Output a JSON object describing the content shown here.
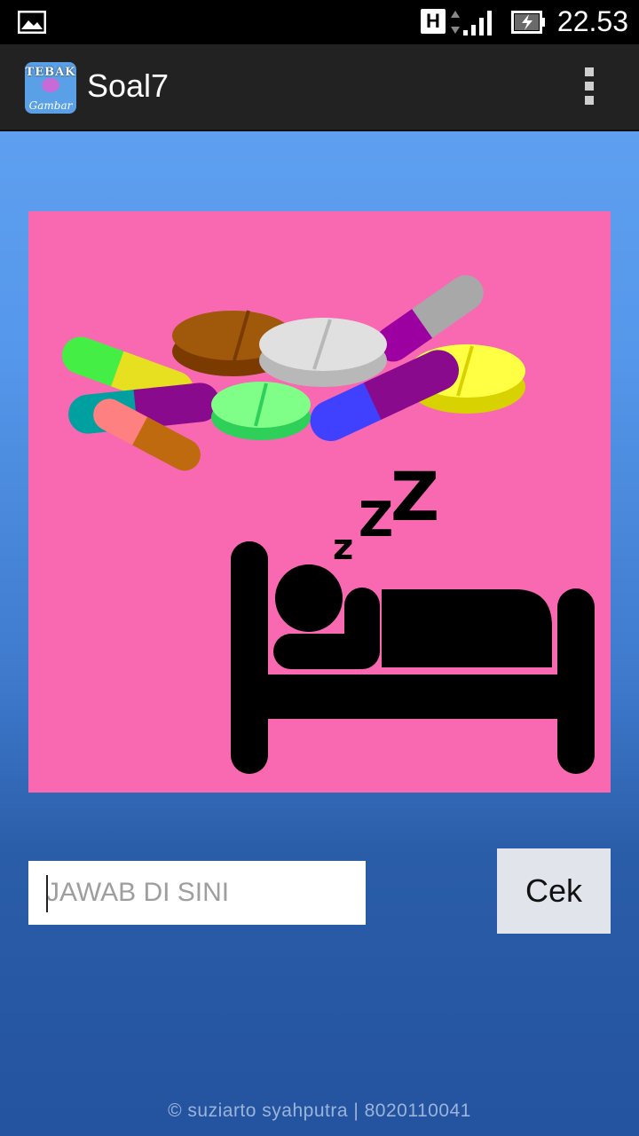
{
  "status_bar": {
    "network_type": "H",
    "time": "22.53"
  },
  "app": {
    "icon_text_top": "TEBAK",
    "icon_text_bottom": "Gambar",
    "title": "Soal7"
  },
  "question": {
    "image_description_icon": "pills-and-sleeping-person-image"
  },
  "answer": {
    "placeholder": "JAWAB DI SINI",
    "value": ""
  },
  "check_button": {
    "label": "Cek"
  },
  "footer": {
    "credit": "© suziarto syahputra | 8020110041"
  },
  "colors": {
    "picture_background": "#f869b1",
    "action_bar": "#222222",
    "button": "#e2e4ec"
  }
}
